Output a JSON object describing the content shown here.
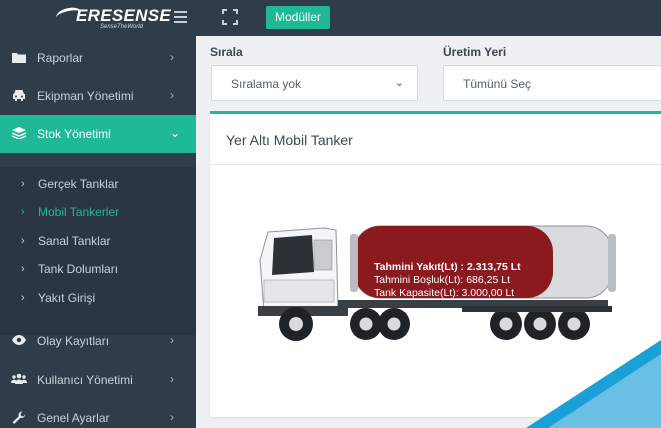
{
  "header": {
    "logo_text": "ERESENSE",
    "logo_tagline": "SenseTheWorld",
    "modules_label": "Modüller"
  },
  "sidebar": {
    "items": [
      {
        "label": "Raporlar",
        "icon": "folder-icon"
      },
      {
        "label": "Ekipman Yönetimi",
        "icon": "car-icon"
      },
      {
        "label": "Stok Yönetimi",
        "icon": "layers-icon",
        "active": true
      },
      {
        "label": "Olay Kayıtları",
        "icon": "eye-icon"
      },
      {
        "label": "Kullanıcı Yönetimi",
        "icon": "users-icon"
      },
      {
        "label": "Genel Ayarlar",
        "icon": "wrench-icon"
      }
    ],
    "submenu": [
      {
        "label": "Gerçek Tanklar"
      },
      {
        "label": "Mobil Tankerler",
        "current": true
      },
      {
        "label": "Sanal Tanklar"
      },
      {
        "label": "Tank Dolumları"
      },
      {
        "label": "Yakıt Girişi"
      }
    ]
  },
  "filters": {
    "sort_label": "Sırala",
    "sort_value": "Sıralama yok",
    "location_label": "Üretim Yeri",
    "location_value": "Tümünü Seç"
  },
  "card": {
    "title": "Yer Altı Mobil Tanker",
    "estimated_fuel": "Tahmini Yakıt(Lt)  : 2.313,75 Lt",
    "estimated_space": "Tahmini Boşluk(Lt): 686,25 Lt",
    "tank_capacity": "Tank Kapasite(Lt): 3.000,00 Lt",
    "fill_ratio": 0.77125
  },
  "colors": {
    "accent": "#1fb997",
    "sidebar_bg": "#2f3d4a",
    "fuel_red": "#8b1a1f",
    "deco_blue": "#1a9fd6"
  }
}
